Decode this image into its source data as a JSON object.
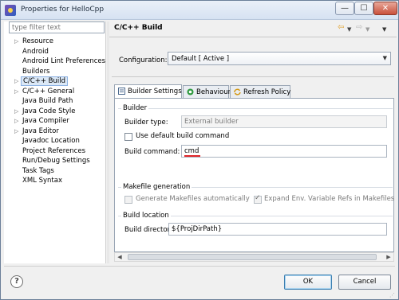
{
  "window": {
    "title": "Properties for HelloCpp",
    "controls": {
      "minimize": "—",
      "maximize": "☐",
      "close": "✕"
    }
  },
  "filter": {
    "placeholder": "type filter text"
  },
  "tree": [
    {
      "label": "Resource",
      "expandable": true
    },
    {
      "label": "Android",
      "expandable": false
    },
    {
      "label": "Android Lint Preferences",
      "expandable": false
    },
    {
      "label": "Builders",
      "expandable": false
    },
    {
      "label": "C/C++ Build",
      "expandable": true,
      "selected": true
    },
    {
      "label": "C/C++ General",
      "expandable": true
    },
    {
      "label": "Java Build Path",
      "expandable": false
    },
    {
      "label": "Java Code Style",
      "expandable": true
    },
    {
      "label": "Java Compiler",
      "expandable": true
    },
    {
      "label": "Java Editor",
      "expandable": true
    },
    {
      "label": "Javadoc Location",
      "expandable": false
    },
    {
      "label": "Project References",
      "expandable": false
    },
    {
      "label": "Run/Debug Settings",
      "expandable": false
    },
    {
      "label": "Task Tags",
      "expandable": false
    },
    {
      "label": "XML Syntax",
      "expandable": false
    }
  ],
  "page": {
    "title": "C/C++ Build",
    "configuration_label": "Configuration:",
    "configuration_value": "Default  [ Active ]"
  },
  "tabs": [
    {
      "label": "Builder Settings",
      "active": true
    },
    {
      "label": "Behaviour",
      "active": false
    },
    {
      "label": "Refresh Policy",
      "active": false
    }
  ],
  "builder": {
    "group_title": "Builder",
    "type_label": "Builder type:",
    "type_value": "External builder",
    "use_default_label": "Use default build command",
    "use_default_checked": false,
    "command_label": "Build command:",
    "command_value": "cmd"
  },
  "makefile": {
    "group_title": "Makefile generation",
    "generate_label": "Generate Makefiles automatically",
    "generate_checked": false,
    "expand_label": "Expand Env. Variable Refs in Makefiles",
    "expand_checked": true
  },
  "location": {
    "group_title": "Build location",
    "directory_label": "Build directory:",
    "directory_value": "${ProjDirPath}"
  },
  "buttons": {
    "ok": "OK",
    "cancel": "Cancel",
    "help": "?"
  },
  "colors": {
    "selection": "#dbe8f6",
    "accent_underline": "#e0262a"
  }
}
